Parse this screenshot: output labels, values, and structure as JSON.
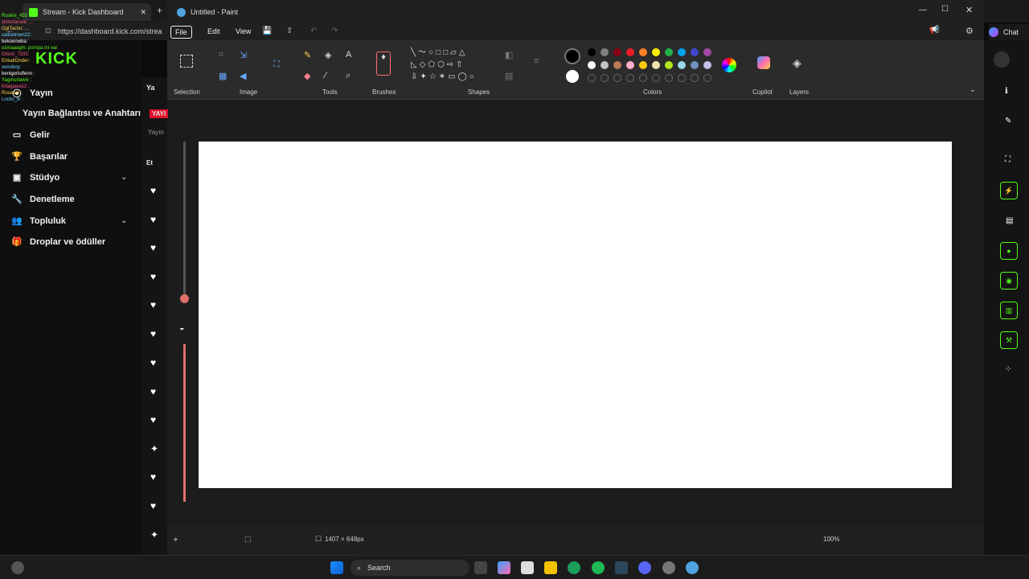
{
  "browser": {
    "tabs": [
      {
        "label": "Stream - Kick Dashboard"
      },
      {
        "label": "Untitled - Paint"
      }
    ],
    "url": "https://dashboard.kick.com/strea",
    "chat_label": "Chat"
  },
  "kick": {
    "logo": "KICK",
    "chat_lines": [
      "Rookie_455 :",
      "shinofarsee: ...",
      "OgiTacho: ...",
      "salicetmen22:",
      "bekoenwba:",
      "osmaaagm: pompa mi var",
      "Ghost_7333:",
      "ErikaltOnder:",
      "xenoboy:",
      "benigorlutfenn :",
      "Yagmurlawix :",
      "Kitagawa12 :",
      "Ruuaiue :",
      "Locks_w :"
    ],
    "sidebar": [
      {
        "label": "Yayın",
        "icon": "broadcast-icon"
      },
      {
        "label": "Yayın Bağlantısı ve Anahtarı",
        "icon": "key-icon"
      },
      {
        "label": "Gelir",
        "icon": "money-icon"
      },
      {
        "label": "Başarılar",
        "icon": "trophy-icon"
      },
      {
        "label": "Stüdyo",
        "icon": "studio-icon"
      },
      {
        "label": "Denetleme",
        "icon": "wrench-icon"
      },
      {
        "label": "Topluluk",
        "icon": "people-icon"
      },
      {
        "label": "Droplar ve ödüller",
        "icon": "gift-icon"
      }
    ],
    "col2": {
      "header": "Ya",
      "live_badge": "YAYI",
      "yayin": "Yayın",
      "etk": "Et"
    }
  },
  "paint": {
    "title": "Untitled - Paint",
    "menus": [
      "File",
      "Edit",
      "View"
    ],
    "groups": [
      "Selection",
      "Image",
      "Tools",
      "Brushes",
      "Shapes",
      "Colors",
      "Copilot",
      "Layers"
    ],
    "colors": {
      "row1": [
        "#000000",
        "#7f7f7f",
        "#880015",
        "#ed1c24",
        "#ff7f27",
        "#fff200",
        "#22b14c",
        "#00a2e8",
        "#3f48cc",
        "#a349a4"
      ],
      "row2": [
        "#ffffff",
        "#c3c3c3",
        "#b97a57",
        "#ffaec9",
        "#ffc90e",
        "#efe4b0",
        "#b5e61d",
        "#99d9ea",
        "#7092be",
        "#c8bfe7"
      ]
    },
    "status": {
      "size": "1407 × 648px",
      "zoom": "100%"
    }
  },
  "taskbar": {
    "search_placeholder": "Search"
  },
  "accent": "#53fc18"
}
